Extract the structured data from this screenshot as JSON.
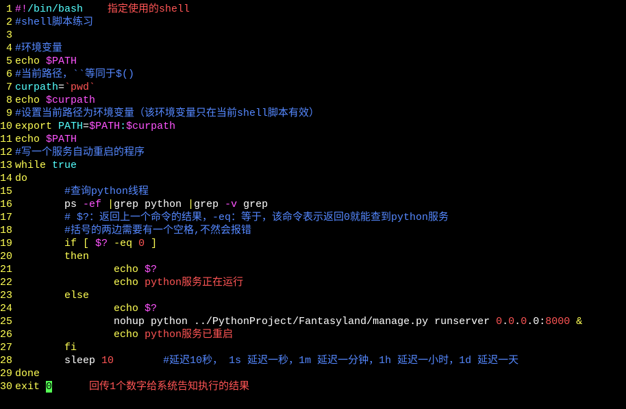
{
  "lines": [
    {
      "n": 1,
      "tokens": [
        {
          "c": "mag",
          "t": "#!"
        },
        {
          "c": "cyn",
          "t": "/bin/bash"
        },
        {
          "c": "wht",
          "t": "    "
        },
        {
          "c": "red",
          "t": "指定使用的shell"
        }
      ]
    },
    {
      "n": 2,
      "tokens": [
        {
          "c": "blu",
          "t": "#shell脚本练习"
        }
      ]
    },
    {
      "n": 3,
      "tokens": []
    },
    {
      "n": 4,
      "tokens": [
        {
          "c": "blu",
          "t": "#环境变量"
        }
      ]
    },
    {
      "n": 5,
      "tokens": [
        {
          "c": "ylw",
          "t": "echo"
        },
        {
          "c": "wht",
          "t": " "
        },
        {
          "c": "mag",
          "t": "$PATH"
        }
      ]
    },
    {
      "n": 6,
      "tokens": [
        {
          "c": "blu",
          "t": "#当前路径，``等同于$()"
        }
      ]
    },
    {
      "n": 7,
      "tokens": [
        {
          "c": "cyn",
          "t": "curpath"
        },
        {
          "c": "wht",
          "t": "="
        },
        {
          "c": "red",
          "t": "`pwd`"
        }
      ]
    },
    {
      "n": 8,
      "tokens": [
        {
          "c": "ylw",
          "t": "echo"
        },
        {
          "c": "wht",
          "t": " "
        },
        {
          "c": "mag",
          "t": "$curpath"
        }
      ]
    },
    {
      "n": 9,
      "tokens": [
        {
          "c": "blu",
          "t": "#设置当前路径为环境变量（该环境变量只在当前shell脚本有效）"
        }
      ]
    },
    {
      "n": 10,
      "tokens": [
        {
          "c": "ylw",
          "t": "export"
        },
        {
          "c": "wht",
          "t": " "
        },
        {
          "c": "cyn",
          "t": "PATH"
        },
        {
          "c": "wht",
          "t": "="
        },
        {
          "c": "mag",
          "t": "$PATH"
        },
        {
          "c": "cyn",
          "t": ":"
        },
        {
          "c": "mag",
          "t": "$curpath"
        }
      ]
    },
    {
      "n": 11,
      "tokens": [
        {
          "c": "ylw",
          "t": "echo"
        },
        {
          "c": "wht",
          "t": " "
        },
        {
          "c": "mag",
          "t": "$PATH"
        }
      ]
    },
    {
      "n": 12,
      "tokens": [
        {
          "c": "blu",
          "t": "#写一个服务自动重启的程序"
        }
      ]
    },
    {
      "n": 13,
      "tokens": [
        {
          "c": "ylw",
          "t": "while"
        },
        {
          "c": "wht",
          "t": " "
        },
        {
          "c": "cyn",
          "t": "true"
        }
      ]
    },
    {
      "n": 14,
      "tokens": [
        {
          "c": "ylw",
          "t": "do"
        }
      ]
    },
    {
      "n": 15,
      "tokens": [
        {
          "c": "wht",
          "t": "        "
        },
        {
          "c": "blu",
          "t": "#查询python线程"
        }
      ]
    },
    {
      "n": 16,
      "tokens": [
        {
          "c": "wht",
          "t": "        ps "
        },
        {
          "c": "mag",
          "t": "-ef"
        },
        {
          "c": "wht",
          "t": " "
        },
        {
          "c": "ylw",
          "t": "|"
        },
        {
          "c": "wht",
          "t": "grep python "
        },
        {
          "c": "ylw",
          "t": "|"
        },
        {
          "c": "wht",
          "t": "grep "
        },
        {
          "c": "mag",
          "t": "-v"
        },
        {
          "c": "wht",
          "t": " grep"
        }
      ]
    },
    {
      "n": 17,
      "tokens": [
        {
          "c": "wht",
          "t": "        "
        },
        {
          "c": "blu",
          "t": "# $?：返回上一个命令的结果，-eq：等于，该命令表示返回0就能查到python服务"
        }
      ]
    },
    {
      "n": 18,
      "tokens": [
        {
          "c": "wht",
          "t": "        "
        },
        {
          "c": "blu",
          "t": "#括号的两边需要有一个空格,不然会报错"
        }
      ]
    },
    {
      "n": 19,
      "tokens": [
        {
          "c": "wht",
          "t": "        "
        },
        {
          "c": "ylw",
          "t": "if"
        },
        {
          "c": "wht",
          "t": " "
        },
        {
          "c": "ylw",
          "t": "["
        },
        {
          "c": "wht",
          "t": " "
        },
        {
          "c": "mag",
          "t": "$?"
        },
        {
          "c": "wht",
          "t": " "
        },
        {
          "c": "ylw",
          "t": "-eq"
        },
        {
          "c": "wht",
          "t": " "
        },
        {
          "c": "red",
          "t": "0"
        },
        {
          "c": "wht",
          "t": " "
        },
        {
          "c": "ylw",
          "t": "]"
        }
      ]
    },
    {
      "n": 20,
      "tokens": [
        {
          "c": "wht",
          "t": "        "
        },
        {
          "c": "ylw",
          "t": "then"
        }
      ]
    },
    {
      "n": 21,
      "tokens": [
        {
          "c": "wht",
          "t": "                "
        },
        {
          "c": "ylw",
          "t": "echo"
        },
        {
          "c": "wht",
          "t": " "
        },
        {
          "c": "mag",
          "t": "$?"
        }
      ]
    },
    {
      "n": 22,
      "tokens": [
        {
          "c": "wht",
          "t": "                "
        },
        {
          "c": "ylw",
          "t": "echo"
        },
        {
          "c": "wht",
          "t": " "
        },
        {
          "c": "red",
          "t": "python服务正在运行"
        }
      ]
    },
    {
      "n": 23,
      "tokens": [
        {
          "c": "wht",
          "t": "        "
        },
        {
          "c": "ylw",
          "t": "else"
        }
      ]
    },
    {
      "n": 24,
      "tokens": [
        {
          "c": "wht",
          "t": "                "
        },
        {
          "c": "ylw",
          "t": "echo"
        },
        {
          "c": "wht",
          "t": " "
        },
        {
          "c": "mag",
          "t": "$?"
        }
      ]
    },
    {
      "n": 25,
      "tokens": [
        {
          "c": "wht",
          "t": "                nohup python ../PythonProject/Fantasyland/manage.py runserver "
        },
        {
          "c": "red",
          "t": "0"
        },
        {
          "c": "wht",
          "t": "."
        },
        {
          "c": "red",
          "t": "0"
        },
        {
          "c": "wht",
          "t": "."
        },
        {
          "c": "red",
          "t": "0"
        },
        {
          "c": "wht",
          "t": ".0:"
        },
        {
          "c": "red",
          "t": "8000"
        },
        {
          "c": "wht",
          "t": " "
        },
        {
          "c": "ylw",
          "t": "&"
        }
      ]
    },
    {
      "n": 26,
      "tokens": [
        {
          "c": "wht",
          "t": "                "
        },
        {
          "c": "ylw",
          "t": "echo"
        },
        {
          "c": "wht",
          "t": " "
        },
        {
          "c": "red",
          "t": "python服务已重启"
        }
      ]
    },
    {
      "n": 27,
      "tokens": [
        {
          "c": "wht",
          "t": "        "
        },
        {
          "c": "ylw",
          "t": "fi"
        }
      ]
    },
    {
      "n": 28,
      "tokens": [
        {
          "c": "wht",
          "t": "        sleep "
        },
        {
          "c": "red",
          "t": "10"
        },
        {
          "c": "wht",
          "t": "        "
        },
        {
          "c": "blu",
          "t": "#延迟10秒， 1s 延迟一秒，1m 延迟一分钟，1h 延迟一小时，1d 延迟一天"
        }
      ]
    },
    {
      "n": 29,
      "tokens": [
        {
          "c": "ylw",
          "t": "done"
        }
      ]
    },
    {
      "n": 30,
      "tokens": [
        {
          "c": "ylw",
          "t": "exit"
        },
        {
          "c": "wht",
          "t": " "
        },
        {
          "c": "sel",
          "t": "0"
        },
        {
          "c": "wht",
          "t": "      "
        },
        {
          "c": "red",
          "t": "回传1个数字给系统告知执行的结果"
        }
      ]
    }
  ]
}
